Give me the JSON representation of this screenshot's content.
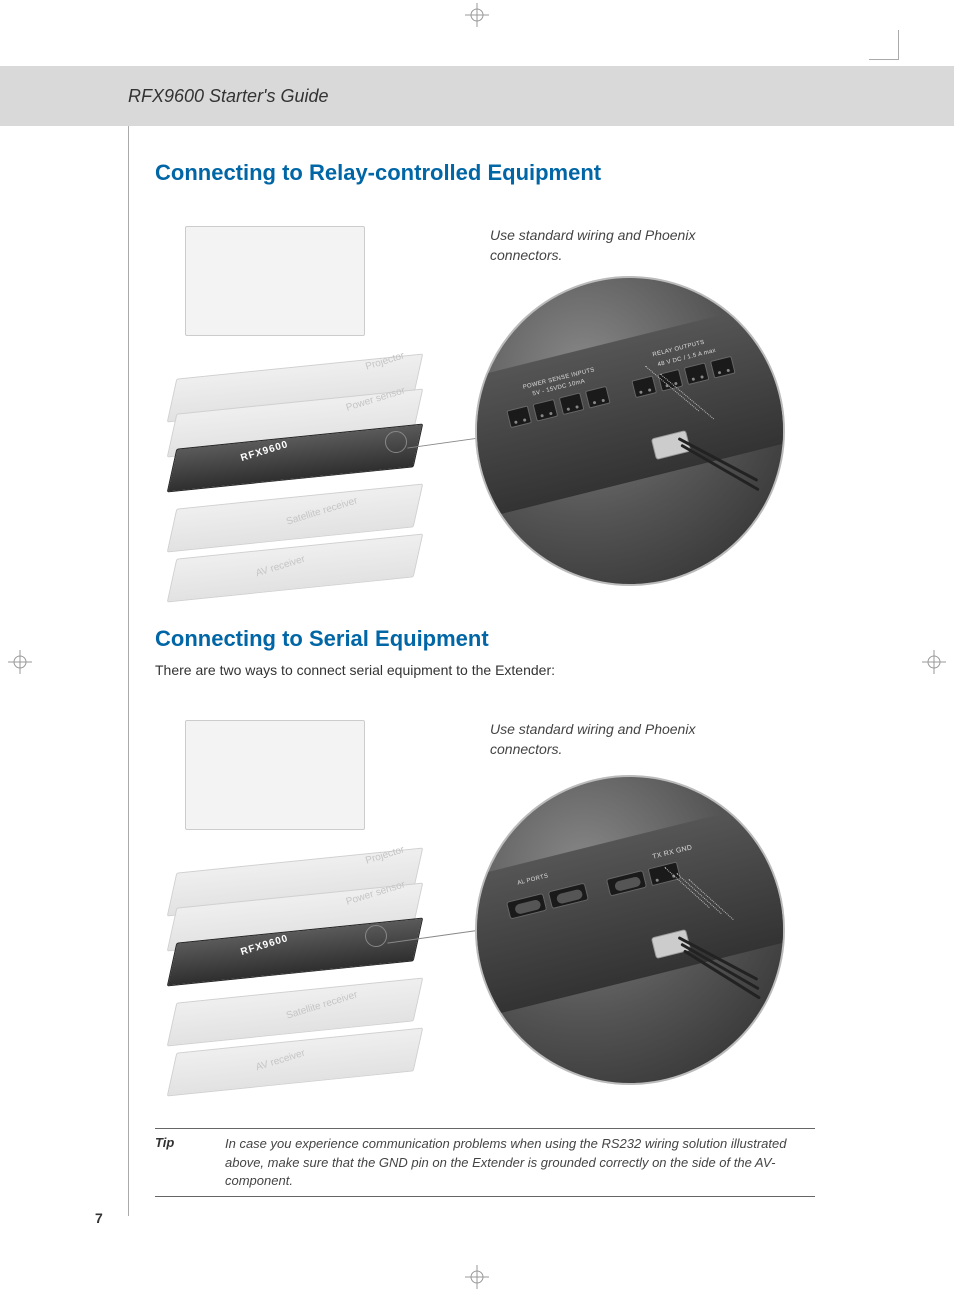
{
  "header": {
    "title": "RFX9600 Starter's Guide"
  },
  "section1": {
    "heading": "Connecting to Relay-controlled Equipment",
    "caption": "Use standard wiring and Phoenix connectors.",
    "port_group_1_label": "POWER SENSE INPUTS",
    "port_group_1_sub": "5V - 15VDC 10mA",
    "port_group_2_label": "RELAY OUTPUTS",
    "port_group_2_sub": "48 V DC / 1.5 A max",
    "device_name": "RFX9600",
    "labels": {
      "projector": "Projector",
      "sensor": "Power sensor",
      "sat": "Satellite receiver",
      "av": "AV receiver"
    }
  },
  "section2": {
    "heading": "Connecting to Serial Equipment",
    "intro": "There are two ways to connect serial equipment to the Extender:",
    "caption": "Use standard wiring and Phoenix connectors.",
    "port_area_label": "AL PORTS",
    "pin_label": "TX  RX  GND",
    "device_name": "RFX9600",
    "labels": {
      "projector": "Projector",
      "sensor": "Power sensor",
      "sat": "Satellite receiver",
      "av": "AV receiver"
    }
  },
  "tip": {
    "label": "Tip",
    "text": "In case you experience communication problems when using the RS232 wiring solution illustrated above, make sure that the GND pin on the Extender is grounded correctly on the side of the AV-component."
  },
  "page": "7"
}
